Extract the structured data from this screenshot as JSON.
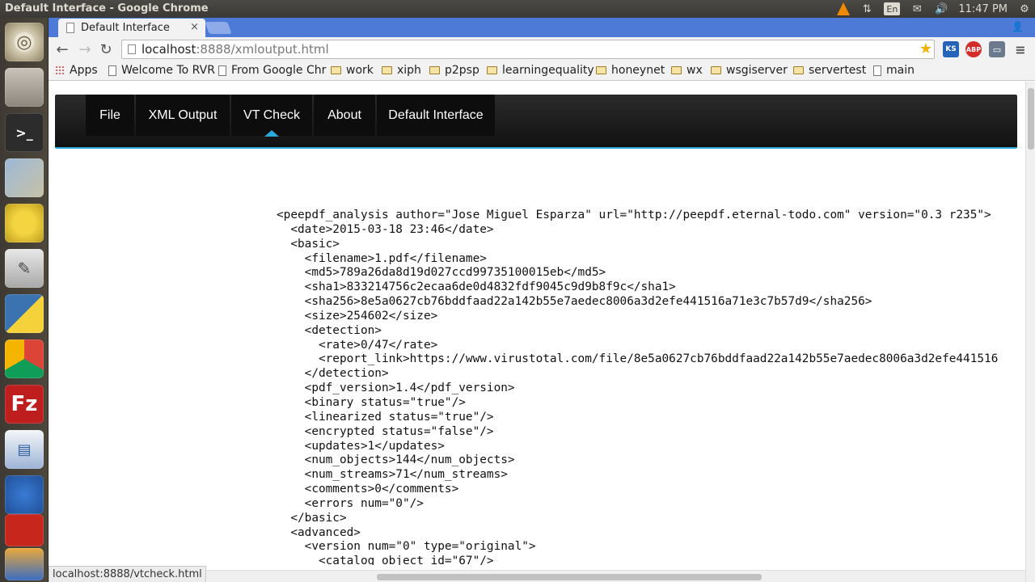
{
  "panel": {
    "window_title": "Default Interface - Google Chrome",
    "lang": "En",
    "clock": "11:47 PM"
  },
  "launcher": {
    "items": [
      "Ubuntu Dash",
      "Files",
      "Terminal",
      "Image Viewer",
      "Teapot",
      "Text Editor",
      "Python",
      "Chrome",
      "FileZilla",
      "Writer",
      "Wireshark",
      "PDF",
      "Stack"
    ]
  },
  "browser": {
    "tab_title": "Default Interface",
    "tab_close": "×",
    "url_host": "localhost",
    "url_path": ":8888/xmloutput.html",
    "extensions": [
      "KS",
      "ABP",
      "cast",
      "menu"
    ],
    "bookmarks": [
      {
        "label": "Apps",
        "icon": "apps"
      },
      {
        "label": "Welcome To RVR",
        "icon": "page"
      },
      {
        "label": "From Google Chr",
        "icon": "page"
      },
      {
        "label": "work",
        "icon": "folder"
      },
      {
        "label": "xiph",
        "icon": "folder"
      },
      {
        "label": "p2psp",
        "icon": "folder"
      },
      {
        "label": "learningequality",
        "icon": "folder"
      },
      {
        "label": "honeynet",
        "icon": "folder"
      },
      {
        "label": "wx",
        "icon": "folder"
      },
      {
        "label": "wsgiserver",
        "icon": "folder"
      },
      {
        "label": "servertest",
        "icon": "folder"
      },
      {
        "label": "main",
        "icon": "page"
      }
    ],
    "status_url": "localhost:8888/vtcheck.html"
  },
  "navbar": {
    "items": [
      "File",
      "XML Output",
      "VT Check",
      "About",
      "Default Interface"
    ],
    "active": "VT Check"
  },
  "xml_lines": [
    "<peepdf_analysis author=\"Jose Miguel Esparza\" url=\"http://peepdf.eternal-todo.com\" version=\"0.3 r235\">",
    "  <date>2015-03-18 23:46</date>",
    "  <basic>",
    "    <filename>1.pdf</filename>",
    "    <md5>789a26da8d19d027ccd99735100015eb</md5>",
    "    <sha1>833214756c2ecaa6de0d4832fdf9045c9d9b8f9c</sha1>",
    "    <sha256>8e5a0627cb76bddfaad22a142b55e7aedec8006a3d2efe441516a71e3c7b57d9</sha256>",
    "    <size>254602</size>",
    "    <detection>",
    "      <rate>0/47</rate>",
    "      <report_link>https://www.virustotal.com/file/8e5a0627cb76bddfaad22a142b55e7aedec8006a3d2efe441516",
    "    </detection>",
    "    <pdf_version>1.4</pdf_version>",
    "    <binary status=\"true\"/>",
    "    <linearized status=\"true\"/>",
    "    <encrypted status=\"false\"/>",
    "    <updates>1</updates>",
    "    <num_objects>144</num_objects>",
    "    <num_streams>71</num_streams>",
    "    <comments>0</comments>",
    "    <errors num=\"0\"/>",
    "  </basic>",
    "  <advanced>",
    "    <version num=\"0\" type=\"original\">",
    "      <catalog object_id=\"67\"/>"
  ],
  "colors": {
    "tabstrip": "#4c7ad6",
    "navbar_accent": "#2aa7db",
    "launcher_bg": "#4d463b"
  }
}
